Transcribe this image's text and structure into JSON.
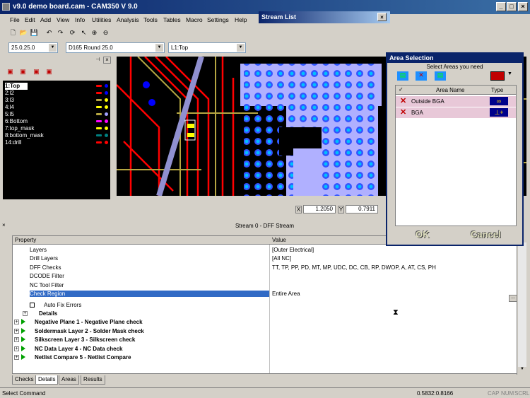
{
  "window": {
    "title": "v9.0 demo board.cam - CAM350 V 9.0"
  },
  "menu": [
    "File",
    "Edit",
    "Add",
    "View",
    "Info",
    "Utilities",
    "Analysis",
    "Tools",
    "Tables",
    "Macro",
    "Settings",
    "Help"
  ],
  "toolbar": {
    "grid_value": "25.0,25.0",
    "dcode_value": "D165  Round 25.0",
    "layer_value": "L1:Top"
  },
  "stream_list": {
    "title": "Stream List"
  },
  "layers": [
    {
      "label": "1:Top",
      "color": "#ff0000",
      "dot": "#0000ff"
    },
    {
      "label": "2:l2",
      "color": "#ff0000",
      "dot": "#0000ff"
    },
    {
      "label": "3:l3",
      "color": "#b5a642",
      "dot": "#ffff00"
    },
    {
      "label": "4:l4",
      "color": "#ffff00",
      "dot": "#ffff00"
    },
    {
      "label": "5:l5",
      "color": "#b5a642",
      "dot": "#a0a0ff"
    },
    {
      "label": "6:Bottom",
      "color": "#ff00ff",
      "dot": "#ff00ff"
    },
    {
      "label": "7:top_mask",
      "color": "#ffff00",
      "dot": "#ffff00"
    },
    {
      "label": "8:bottom_mask",
      "color": "#008080",
      "dot": "#008080"
    },
    {
      "label": "14:drill",
      "color": "#ff0000",
      "dot": "#ff0000"
    }
  ],
  "coords": {
    "x": "1.2050",
    "y": "0.7911"
  },
  "bottom": {
    "header": "Stream 0 - DFF Stream",
    "col_property": "Property",
    "col_value": "Value"
  },
  "properties": [
    {
      "name": "Layers",
      "value": "[Outer Electrical]"
    },
    {
      "name": "Drill Layers",
      "value": "[All NC]"
    },
    {
      "name": "DFF Checks",
      "value": "TT, TP, PP, PD, MT, MP, UDC, DC, CB, RP, DWOP, A, AT, CS, PH"
    },
    {
      "name": "DCODE Filter",
      "value": ""
    },
    {
      "name": "NC Tool Filter",
      "value": ""
    },
    {
      "name": "Check Region",
      "value": "Entire Area"
    }
  ],
  "auto_fix": "Auto Fix Errors",
  "details": "Details",
  "checks": [
    "Negative Plane 1 - Negative Plane check",
    "Soldermask Layer 2 - Solder Mask check",
    "Silkscreen Layer 3 - Silkscreen check",
    "NC Data Layer 4 - NC Data check",
    "Netlist Compare 5 - Netlist Compare"
  ],
  "tabs": [
    "Checks",
    "Details",
    "Areas",
    "Results"
  ],
  "status": {
    "left": "Select Command",
    "coords": "0.5832:0.8166",
    "indicators": [
      "CAP",
      "NUM",
      "SCRL"
    ]
  },
  "area_selection": {
    "title": "Area Selection",
    "prompt": "Select Areas you need",
    "col_name": "Area Name",
    "col_type": "Type",
    "areas": [
      {
        "name": "Outside BGA",
        "type": "∞"
      },
      {
        "name": "BGA",
        "type": "⊥+"
      }
    ],
    "ok": "OK",
    "cancel": "Cancel"
  }
}
